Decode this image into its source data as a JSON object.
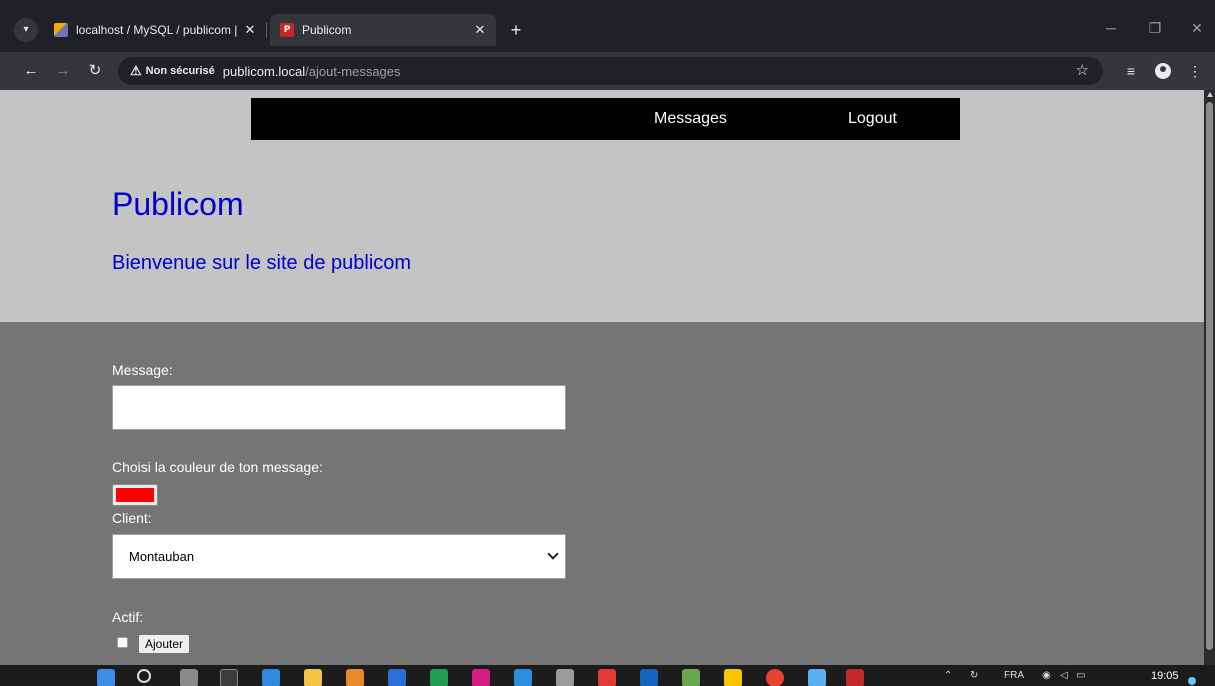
{
  "browser": {
    "tabs": [
      {
        "title": "localhost / MySQL / publicom |",
        "icon": "phpmyadmin-icon",
        "active": false
      },
      {
        "title": "Publicom",
        "icon": "publicom-favicon",
        "active": true
      }
    ],
    "close_glyph": "✕",
    "new_tab_glyph": "+",
    "security_label": "Non sécurisé",
    "url_host": "publicom.local",
    "url_path": "/ajout-messages",
    "favicon_letter": "P"
  },
  "nav": {
    "links": [
      "Messages",
      "Logout"
    ]
  },
  "header": {
    "title": "Publicom",
    "subtitle": "Bienvenue sur le site de publicom"
  },
  "form": {
    "message_label": "Message:",
    "message_value": "",
    "color_label": "Choisi la couleur de ton message:",
    "color_value": "#ff0000",
    "client_label": "Client:",
    "client_selected": "Montauban",
    "actif_label": "Actif:",
    "actif_checked": false,
    "submit_label": "Ajouter"
  },
  "taskbar": {
    "tray_lang": "FRA",
    "clock": "19:05"
  },
  "colors": {
    "header_bg": "#c4c4c4",
    "body_bg": "#757575",
    "title_blue": "#0000cd",
    "nav_bg": "#000000"
  }
}
